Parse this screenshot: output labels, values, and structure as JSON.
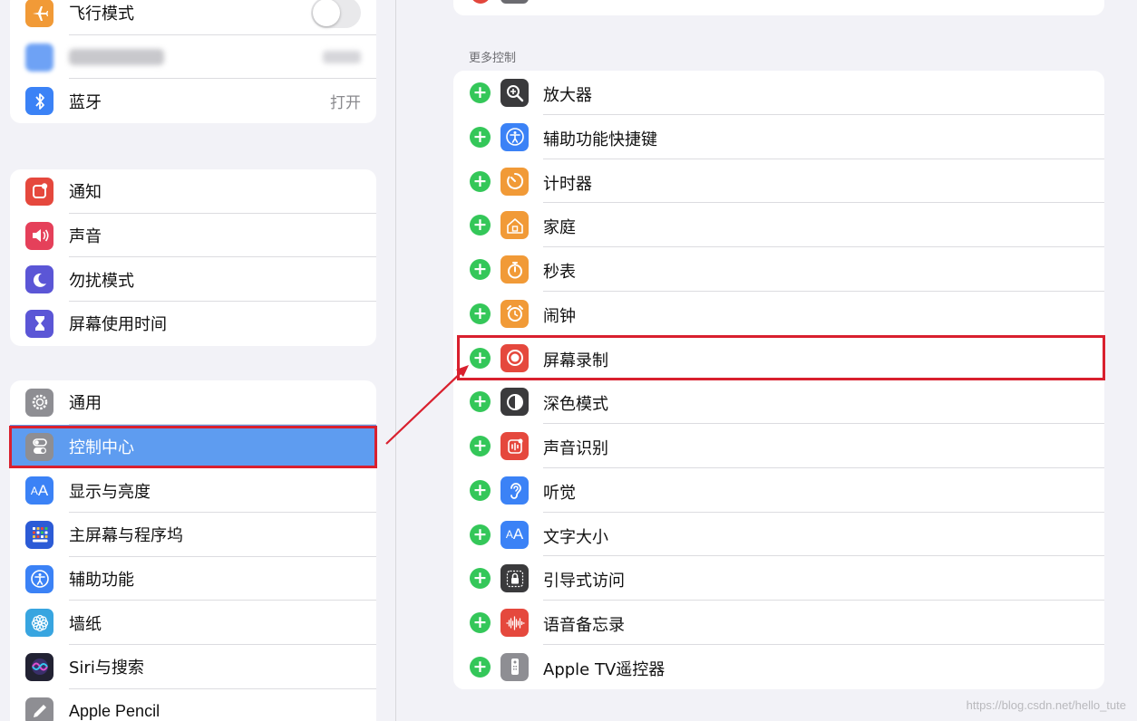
{
  "sidebar": {
    "group1": [
      {
        "label": "飞行模式",
        "icon": "airplane-icon",
        "color": "#f19a37",
        "control": "toggle-off"
      },
      {
        "label": "",
        "icon": "wifi-icon",
        "color": "#3b82f6",
        "value": "",
        "blurred": true
      },
      {
        "label": "蓝牙",
        "icon": "bluetooth-icon",
        "color": "#3b82f6",
        "value": "打开"
      }
    ],
    "group2": [
      {
        "label": "通知",
        "icon": "notification-icon",
        "color": "#e5483d"
      },
      {
        "label": "声音",
        "icon": "speaker-icon",
        "color": "#e5405a"
      },
      {
        "label": "勿扰模式",
        "icon": "moon-icon",
        "color": "#5b56d6"
      },
      {
        "label": "屏幕使用时间",
        "icon": "hourglass-icon",
        "color": "#5b56d6"
      }
    ],
    "group3": [
      {
        "label": "通用",
        "icon": "gear-icon",
        "color": "#8e8e93"
      },
      {
        "label": "控制中心",
        "icon": "switches-icon",
        "color": "#8e8e93",
        "selected": true
      },
      {
        "label": "显示与亮度",
        "icon": "text-size-icon",
        "color": "#3b82f6"
      },
      {
        "label": "主屏幕与程序坞",
        "icon": "home-grid-icon",
        "color": "#2c5bd6"
      },
      {
        "label": "辅助功能",
        "icon": "accessibility-icon",
        "color": "#3b82f6"
      },
      {
        "label": "墙纸",
        "icon": "flower-icon",
        "color": "#38a5e0"
      },
      {
        "label": "Siri与搜索",
        "icon": "siri-icon",
        "color": "#222233"
      },
      {
        "label": "Apple Pencil",
        "icon": "pencil-icon",
        "color": "#8e8e93"
      }
    ]
  },
  "main": {
    "section_header": "更多控制",
    "controls": [
      {
        "label": "放大器",
        "icon": "magnifier-icon",
        "color": "#3a3a3c"
      },
      {
        "label": "辅助功能快捷键",
        "icon": "accessibility-icon",
        "color": "#3b82f6"
      },
      {
        "label": "计时器",
        "icon": "timer-icon",
        "color": "#f19a37"
      },
      {
        "label": "家庭",
        "icon": "home-icon",
        "color": "#f19a37"
      },
      {
        "label": "秒表",
        "icon": "stopwatch-icon",
        "color": "#f19a37"
      },
      {
        "label": "闹钟",
        "icon": "alarm-icon",
        "color": "#f19a37"
      },
      {
        "label": "屏幕录制",
        "icon": "record-icon",
        "color": "#e5483d",
        "highlighted": true
      },
      {
        "label": "深色模式",
        "icon": "dark-mode-icon",
        "color": "#3a3a3c"
      },
      {
        "label": "声音识别",
        "icon": "sound-recognition-icon",
        "color": "#e5483d"
      },
      {
        "label": "听觉",
        "icon": "ear-icon",
        "color": "#3b82f6"
      },
      {
        "label": "文字大小",
        "icon": "text-size-icon",
        "color": "#3b82f6"
      },
      {
        "label": "引导式访问",
        "icon": "lock-icon",
        "color": "#3a3a3c"
      },
      {
        "label": "语音备忘录",
        "icon": "waveform-icon",
        "color": "#e5483d"
      },
      {
        "label": "Apple TV遥控器",
        "icon": "remote-icon",
        "color": "#8e8e93"
      }
    ],
    "plus_symbol": "+"
  },
  "annotation": {
    "highlight_color": "#d9202e"
  },
  "watermark": "https://blog.csdn.net/hello_tute"
}
